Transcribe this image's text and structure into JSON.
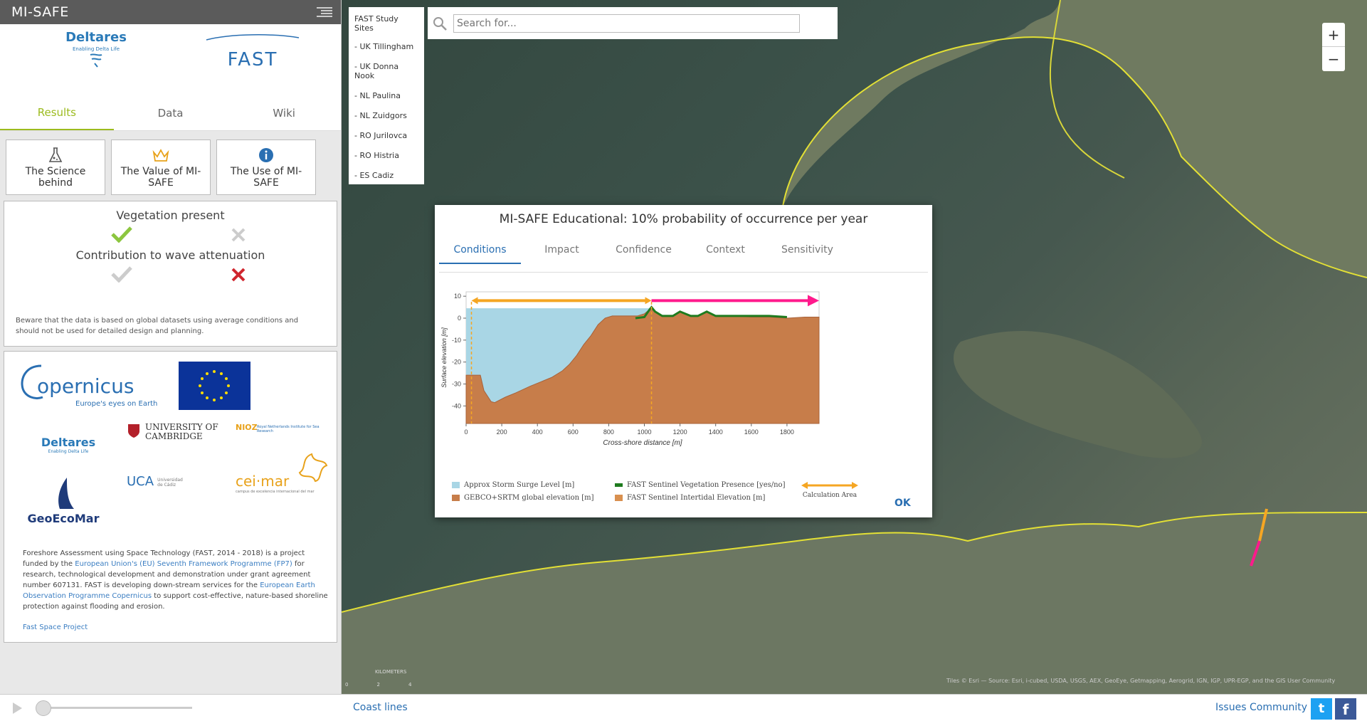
{
  "app": {
    "title": "MI-SAFE"
  },
  "logos": {
    "deltares": "Deltares",
    "deltares_tagline": "Enabling Delta Life",
    "fast": "FAST"
  },
  "tabs": [
    "Results",
    "Data",
    "Wiki"
  ],
  "cards": [
    {
      "label": "The Science behind",
      "icon": "flask-icon"
    },
    {
      "label": "The Value of MI-SAFE",
      "icon": "crown-icon"
    },
    {
      "label": "The Use of MI-SAFE",
      "icon": "info-icon"
    }
  ],
  "vegetation": {
    "present_label": "Vegetation present",
    "attenuation_label": "Contribution to wave attenuation",
    "note": "Beware that the data is based on global datasets using average conditions and should not be used for detailed design and planning."
  },
  "partners": {
    "copernicus": "opernicus",
    "copernicus_tagline": "Europe's eyes on Earth",
    "cambridge": "UNIVERSITY OF CAMBRIDGE",
    "nioz": "NIOZ",
    "nioz_sub": "Royal Netherlands Institute for Sea Research",
    "deltares": "Deltares",
    "deltares_tagline": "Enabling Delta Life",
    "geoecomar": "GeoEcoMar",
    "uca": "UCA",
    "uca_sub": "Universidad de Cádiz",
    "ceimar": "cei·mar",
    "ceimar_sub": "campus de excelencia internacional del mar",
    "desc_1": "Foreshore Assessment using Space Technology (FAST, 2014 - 2018) is a project funded by the ",
    "desc_link1": "European Union's (EU) Seventh Framework Programme (FP7)",
    "desc_2": " for research, technological development and demonstration under grant agreement number 607131. FAST is developing down-stream services for the ",
    "desc_link2": "European Earth Observation Programme Copernicus",
    "desc_3": " to support cost-effective, nature-based shoreline protection against flooding and erosion.",
    "project_link": "Fast Space Project"
  },
  "sites": {
    "header": "FAST Study Sites",
    "items": [
      "- UK Tillingham",
      "- UK Donna Nook",
      "- NL Paulina",
      "- NL Zuidgors",
      "- RO Jurilovca",
      "- RO Histria",
      "- ES Cadiz"
    ]
  },
  "search": {
    "placeholder": "Search for..."
  },
  "zoom": {
    "in": "+",
    "out": "−"
  },
  "scale": {
    "label": "KILOMETERS",
    "ticks": [
      "0",
      "2",
      "4"
    ]
  },
  "attribution": "Tiles © Esri — Source: Esri, i-cubed, USDA, USGS, AEX, GeoEye, Getmapping, Aerogrid, IGN, IGP, UPR-EGP, and the GIS User Community",
  "bottom": {
    "coast_lines": "Coast lines",
    "issues": "Issues",
    "community": "Community"
  },
  "popup": {
    "title": "MI-SAFE Educational: 10% probability of occurrence per year",
    "tabs": [
      "Conditions",
      "Impact",
      "Confidence",
      "Context",
      "Sensitivity"
    ],
    "ok": "OK",
    "legend": [
      {
        "label": "Approx Storm Surge Level [m]",
        "color": "#a9d6e5"
      },
      {
        "label": "GEBCO+SRTM global elevation [m]",
        "color": "#c77d4a"
      },
      {
        "label": "FAST Sentinel Vegetation Presence [yes/no]",
        "color": "#1e7b1e"
      },
      {
        "label": "FAST Sentinel Intertidal Elevation [m]",
        "color": "#d9904f"
      },
      {
        "label": "Calculation Area",
        "color": "#f5a623"
      }
    ]
  },
  "chart_data": {
    "type": "area",
    "xlabel": "Cross-shore distance [m]",
    "ylabel": "Surface elevation [m]",
    "xlim": [
      0,
      1980
    ],
    "ylim": [
      -48,
      12
    ],
    "xticks": [
      0,
      200,
      400,
      600,
      800,
      1000,
      1200,
      1400,
      1600,
      1800
    ],
    "yticks": [
      10,
      0,
      -10,
      -20,
      -30,
      -40
    ],
    "surge_level": 4.5,
    "surge_extent": [
      0,
      1040
    ],
    "calculation_area": [
      30,
      1040
    ],
    "wave_arrow_extent": [
      1040,
      1980
    ],
    "series": [
      {
        "name": "GEBCO+SRTM global elevation [m]",
        "x": [
          0,
          80,
          100,
          140,
          160,
          220,
          280,
          360,
          420,
          480,
          540,
          580,
          620,
          660,
          700,
          740,
          780,
          820,
          860,
          900,
          960,
          1000,
          1030,
          1040,
          1060,
          1100,
          1160,
          1200,
          1260,
          1300,
          1350,
          1400,
          1500,
          1600,
          1700,
          1800,
          1900,
          1980
        ],
        "y": [
          -26,
          -26,
          -33,
          -38,
          -38.5,
          -36,
          -34,
          -31,
          -29,
          -27,
          -24,
          -21,
          -17,
          -12,
          -8,
          -3,
          0,
          1,
          1,
          1,
          1,
          2,
          4,
          5,
          3,
          1,
          1,
          3,
          1,
          1,
          3,
          1,
          1,
          0.5,
          0.5,
          0,
          0.5,
          0.5
        ]
      },
      {
        "name": "FAST Sentinel Vegetation Presence [yes/no]",
        "x": [
          950,
          1000,
          1030,
          1040,
          1060,
          1100,
          1160,
          1200,
          1260,
          1300,
          1350,
          1400,
          1500,
          1600,
          1700,
          1800
        ],
        "y": [
          0,
          0.5,
          4,
          5,
          3,
          1,
          1,
          3,
          1,
          1,
          3,
          1,
          1,
          1,
          1,
          0.5
        ]
      }
    ]
  }
}
